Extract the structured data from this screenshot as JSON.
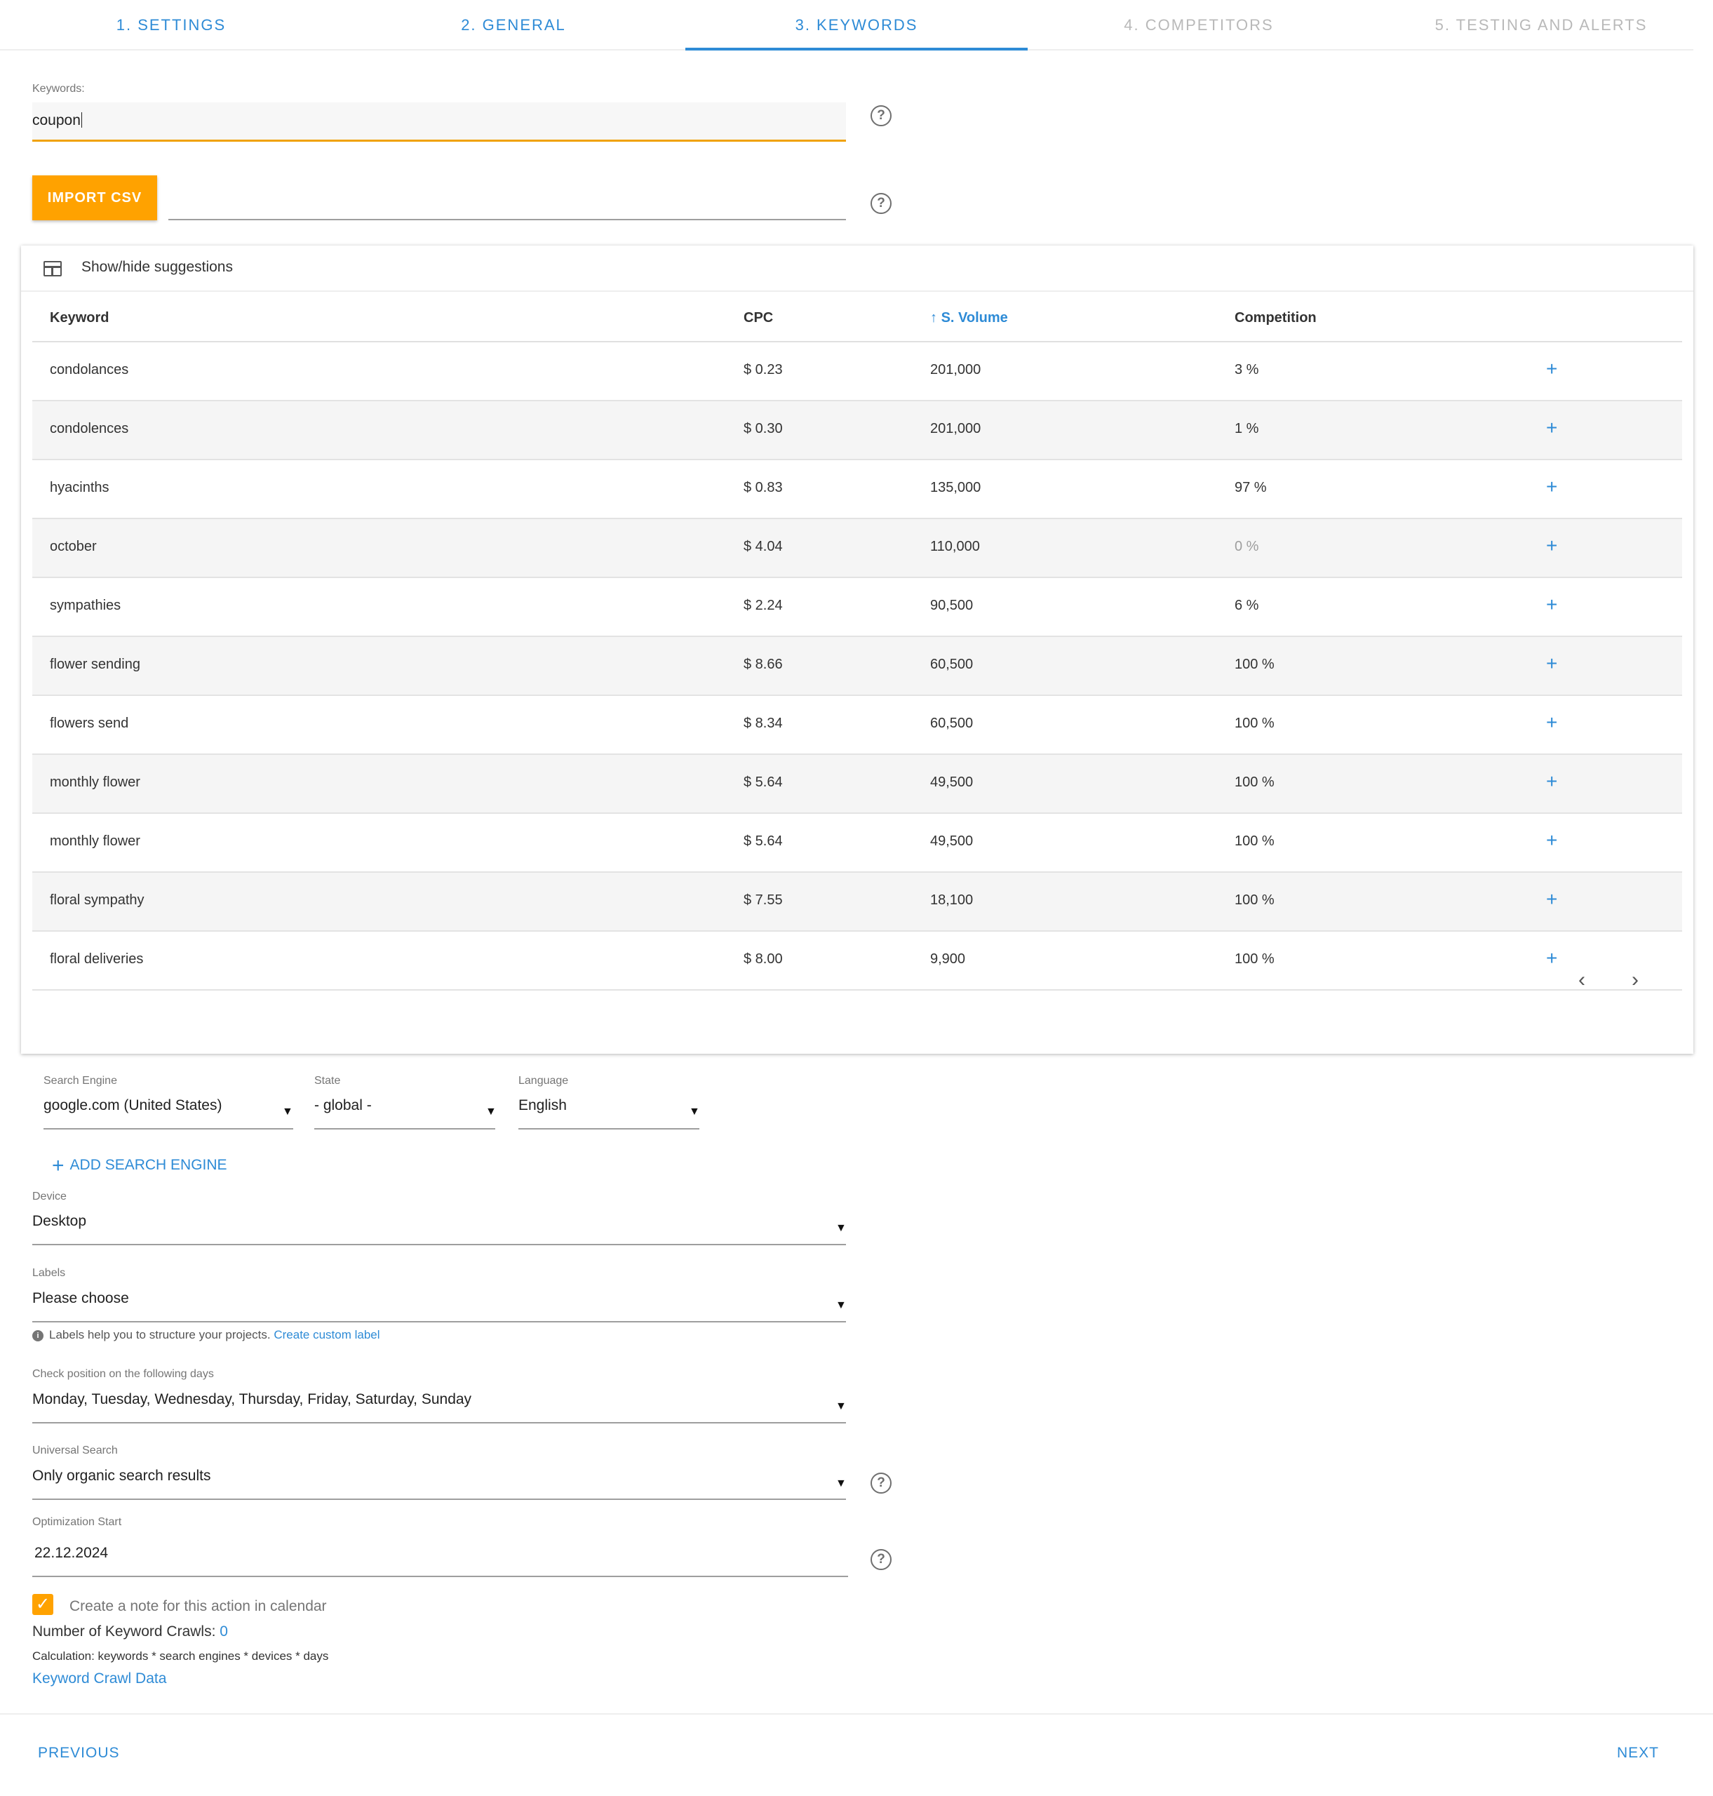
{
  "tabs": [
    {
      "label": "1. SETTINGS",
      "state": "done"
    },
    {
      "label": "2. GENERAL",
      "state": "done"
    },
    {
      "label": "3. KEYWORDS",
      "state": "active"
    },
    {
      "label": "4. COMPETITORS",
      "state": "todo"
    },
    {
      "label": "5. TESTING AND ALERTS",
      "state": "todo"
    }
  ],
  "keywords": {
    "label": "Keywords:",
    "value": "coupon"
  },
  "import": {
    "button_label": "IMPORT CSV",
    "value": ""
  },
  "suggestions": {
    "toggle_label": "Show/hide suggestions",
    "columns": {
      "keyword": "Keyword",
      "cpc": "CPC",
      "volume": "S. Volume",
      "competition": "Competition"
    },
    "sort_icon": "arrow-up-icon",
    "rows": [
      {
        "keyword": "condolances",
        "cpc": "$ 0.23",
        "volume": "201,000",
        "competition": "3 %"
      },
      {
        "keyword": "condolences",
        "cpc": "$ 0.30",
        "volume": "201,000",
        "competition": "1 %"
      },
      {
        "keyword": "hyacinths",
        "cpc": "$ 0.83",
        "volume": "135,000",
        "competition": "97 %"
      },
      {
        "keyword": "october",
        "cpc": "$ 4.04",
        "volume": "110,000",
        "competition": "0 %"
      },
      {
        "keyword": "sympathies",
        "cpc": "$ 2.24",
        "volume": "90,500",
        "competition": "6 %"
      },
      {
        "keyword": "flower sending",
        "cpc": "$ 8.66",
        "volume": "60,500",
        "competition": "100 %"
      },
      {
        "keyword": "flowers send",
        "cpc": "$ 8.34",
        "volume": "60,500",
        "competition": "100 %"
      },
      {
        "keyword": "monthly flower",
        "cpc": "$ 5.64",
        "volume": "49,500",
        "competition": "100 %"
      },
      {
        "keyword": "monthly flower",
        "cpc": "$ 5.64",
        "volume": "49,500",
        "competition": "100 %"
      },
      {
        "keyword": "floral sympathy",
        "cpc": "$ 7.55",
        "volume": "18,100",
        "competition": "100 %"
      },
      {
        "keyword": "floral deliveries",
        "cpc": "$ 8.00",
        "volume": "9,900",
        "competition": "100 %"
      }
    ],
    "add_symbol": "+",
    "pager": {
      "prev": "‹",
      "next": "›"
    }
  },
  "search_engine": {
    "engine_label": "Search Engine",
    "engine_value": "google.com (United States)",
    "state_label": "State",
    "state_value": "- global -",
    "language_label": "Language",
    "language_value": "English",
    "add_label": "ADD SEARCH ENGINE"
  },
  "device": {
    "label": "Device",
    "value": "Desktop"
  },
  "labels": {
    "label": "Labels",
    "value": "Please choose",
    "hint": "Labels help you to structure your projects.",
    "hint_link": "Create custom label"
  },
  "days": {
    "label": "Check position on the following days",
    "value": "Monday, Tuesday, Wednesday, Thursday, Friday, Saturday, Sunday"
  },
  "universal": {
    "label": "Universal Search",
    "value": "Only organic search results"
  },
  "optimization": {
    "label": "Optimization Start",
    "value": "22.12.2024"
  },
  "note": {
    "checked": true,
    "label": "Create a note for this action in calendar"
  },
  "crawls": {
    "label": "Number of Keyword Crawls:",
    "value": "0",
    "calculation": "Calculation: keywords * search engines * devices * days",
    "link": "Keyword Crawl Data"
  },
  "footer": {
    "previous": "PREVIOUS",
    "next": "NEXT"
  },
  "colors": {
    "accent": "#2e8bd6",
    "warning": "#ffa200",
    "muted": "#b9b9b9"
  }
}
